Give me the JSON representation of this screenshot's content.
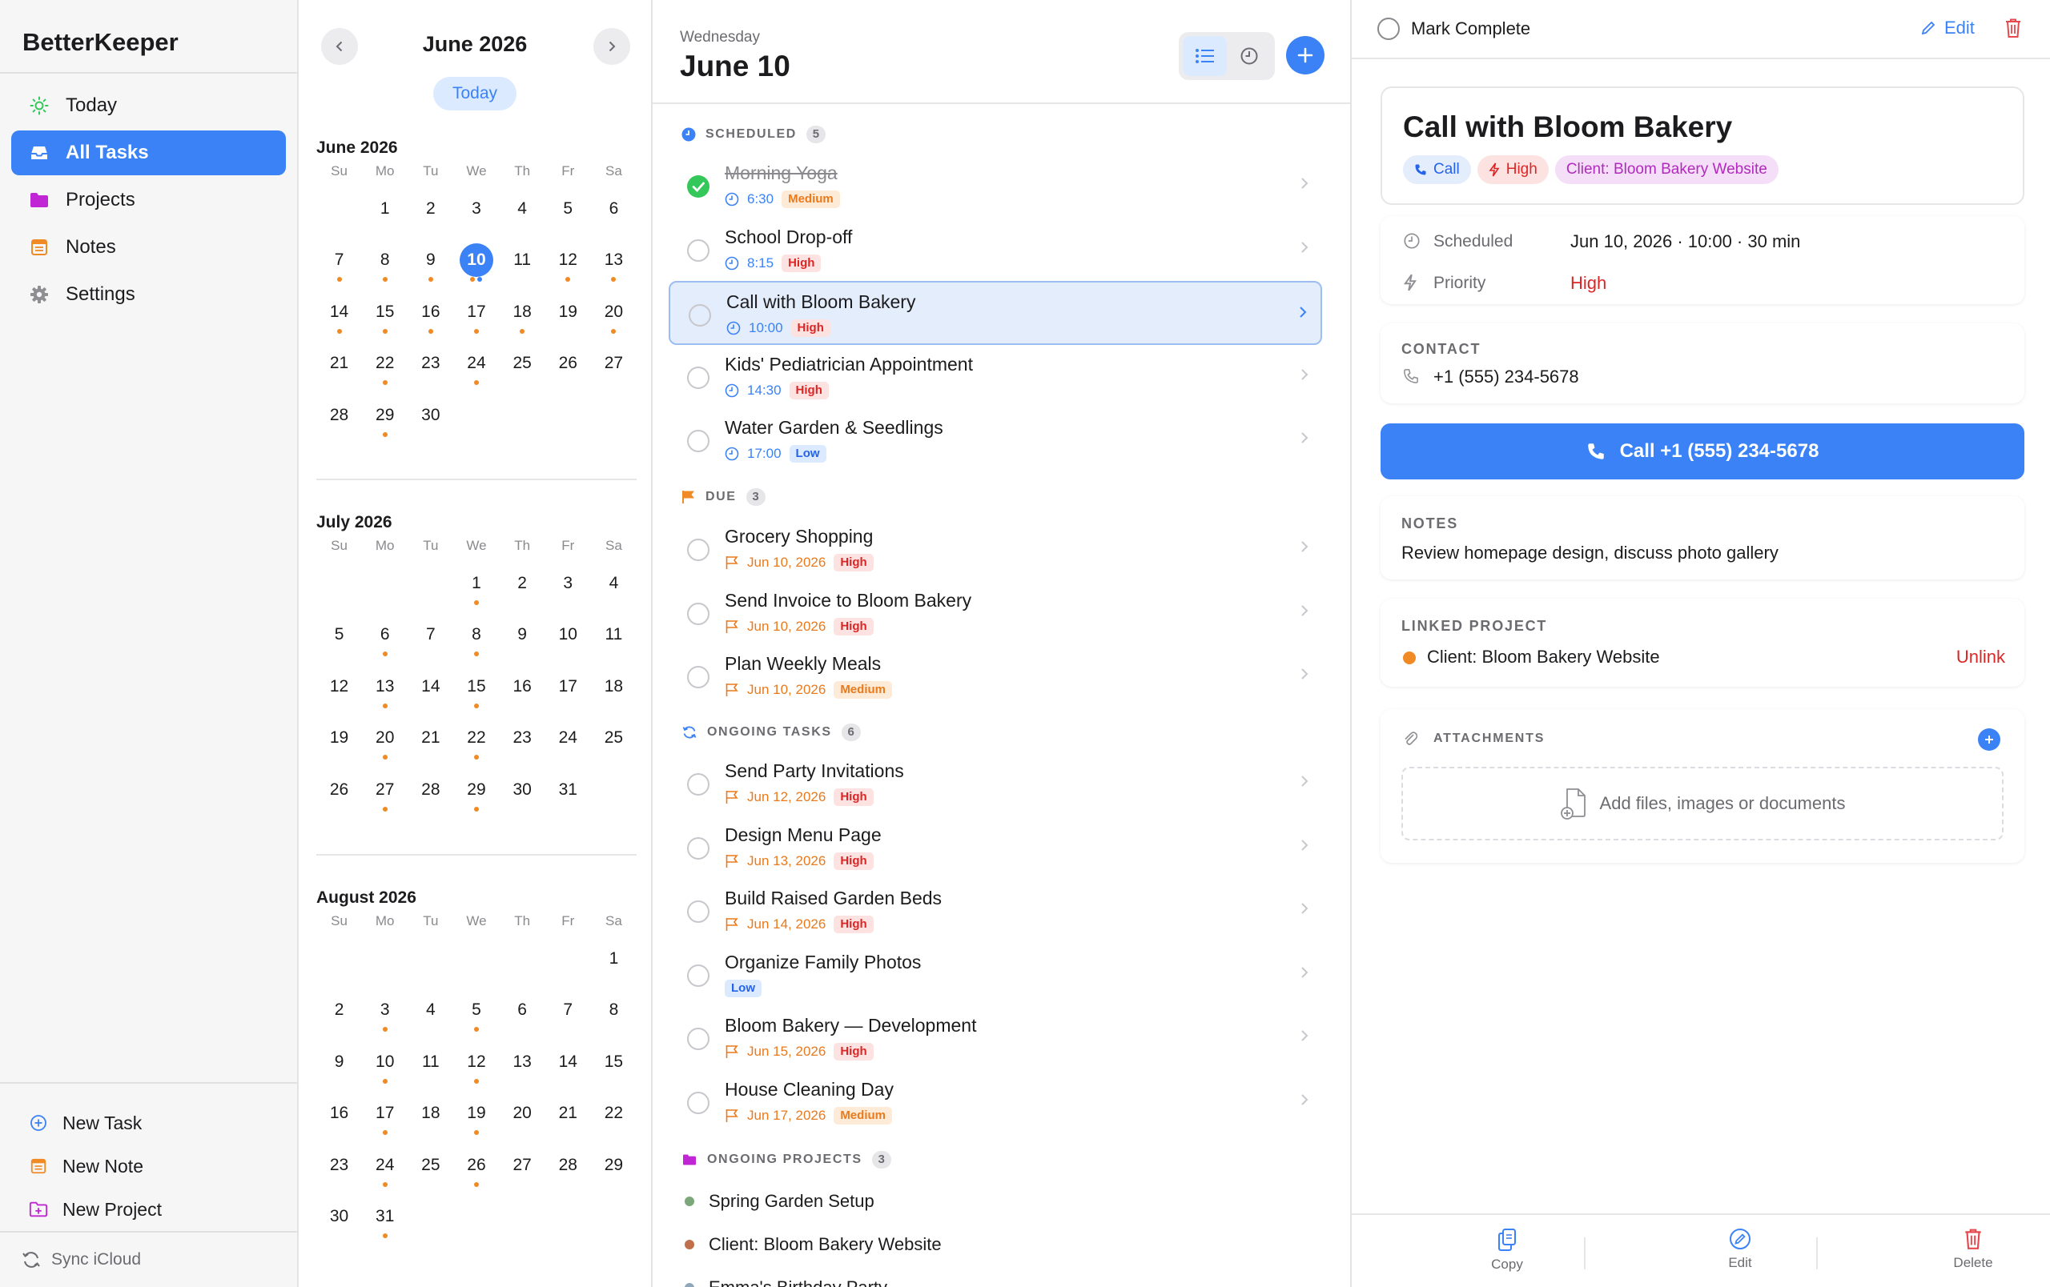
{
  "sidebar": {
    "app_name": "BetterKeeper",
    "nav": [
      {
        "label": "Today",
        "icon": "sun-icon"
      },
      {
        "label": "All Tasks",
        "icon": "inbox-icon",
        "active": true
      },
      {
        "label": "Projects",
        "icon": "folder-icon"
      },
      {
        "label": "Notes",
        "icon": "note-icon"
      },
      {
        "label": "Settings",
        "icon": "gear-icon"
      }
    ],
    "actions": [
      {
        "label": "New Task",
        "icon": "plus-circle-icon"
      },
      {
        "label": "New Note",
        "icon": "note-icon"
      },
      {
        "label": "New Project",
        "icon": "folder-plus-icon"
      }
    ],
    "sync_label": "Sync iCloud"
  },
  "calendar": {
    "title": "June 2026",
    "today_label": "Today",
    "weekdays": [
      "Su",
      "Mo",
      "Tu",
      "We",
      "Th",
      "Fr",
      "Sa"
    ],
    "months": [
      {
        "name": "June 2026",
        "first_weekday": 1,
        "days": 30,
        "selected": 10,
        "dots": {
          "7": [
            "o"
          ],
          "8": [
            "o"
          ],
          "9": [
            "o"
          ],
          "10": [
            "o",
            "b"
          ],
          "12": [
            "o"
          ],
          "13": [
            "o"
          ],
          "14": [
            "o"
          ],
          "15": [
            "o"
          ],
          "16": [
            "o"
          ],
          "17": [
            "o"
          ],
          "18": [
            "o"
          ],
          "20": [
            "o"
          ],
          "22": [
            "o"
          ],
          "24": [
            "o"
          ],
          "29": [
            "o"
          ]
        }
      },
      {
        "name": "July 2026",
        "first_weekday": 3,
        "days": 31,
        "selected": null,
        "dots": {
          "1": [
            "o"
          ],
          "6": [
            "o"
          ],
          "8": [
            "o"
          ],
          "13": [
            "o"
          ],
          "15": [
            "o"
          ],
          "20": [
            "o"
          ],
          "22": [
            "o"
          ],
          "27": [
            "o"
          ],
          "29": [
            "o"
          ]
        }
      },
      {
        "name": "August 2026",
        "first_weekday": 6,
        "days": 31,
        "selected": null,
        "dots": {
          "3": [
            "o"
          ],
          "5": [
            "o"
          ],
          "10": [
            "o"
          ],
          "12": [
            "o"
          ],
          "17": [
            "o"
          ],
          "19": [
            "o"
          ],
          "24": [
            "o"
          ],
          "26": [
            "o"
          ],
          "31": [
            "o"
          ]
        }
      }
    ]
  },
  "list": {
    "weekday": "Wednesday",
    "date": "June 10",
    "sections": [
      {
        "label": "SCHEDULED",
        "count": "5"
      },
      {
        "label": "DUE",
        "count": "3"
      },
      {
        "label": "ONGOING TASKS",
        "count": "6"
      },
      {
        "label": "ONGOING PROJECTS",
        "count": "3"
      }
    ],
    "scheduled": [
      {
        "title": "Morning Yoga",
        "time": "6:30",
        "priority": "Medium",
        "done": true
      },
      {
        "title": "School Drop-off",
        "time": "8:15",
        "priority": "High"
      },
      {
        "title": "Call with Bloom Bakery",
        "time": "10:00",
        "priority": "High",
        "selected": true
      },
      {
        "title": "Kids' Pediatrician Appointment",
        "time": "14:30",
        "priority": "High"
      },
      {
        "title": "Water Garden & Seedlings",
        "time": "17:00",
        "priority": "Low"
      }
    ],
    "due": [
      {
        "title": "Grocery Shopping",
        "date": "Jun 10, 2026",
        "priority": "High"
      },
      {
        "title": "Send Invoice to Bloom Bakery",
        "date": "Jun 10, 2026",
        "priority": "High"
      },
      {
        "title": "Plan Weekly Meals",
        "date": "Jun 10, 2026",
        "priority": "Medium"
      }
    ],
    "ongoing": [
      {
        "title": "Send Party Invitations",
        "date": "Jun 12, 2026",
        "priority": "High"
      },
      {
        "title": "Design Menu Page",
        "date": "Jun 13, 2026",
        "priority": "High"
      },
      {
        "title": "Build Raised Garden Beds",
        "date": "Jun 14, 2026",
        "priority": "High"
      },
      {
        "title": "Organize Family Photos",
        "date": "",
        "priority": "Low"
      },
      {
        "title": "Bloom Bakery — Development",
        "date": "Jun 15, 2026",
        "priority": "High"
      },
      {
        "title": "House Cleaning Day",
        "date": "Jun 17, 2026",
        "priority": "Medium"
      }
    ],
    "projects": [
      {
        "name": "Spring Garden Setup",
        "color": "#7aa87a"
      },
      {
        "name": "Client: Bloom Bakery Website",
        "color": "#c0704a"
      },
      {
        "name": "Emma's Birthday Party",
        "color": "#8fa6b8"
      }
    ]
  },
  "detail": {
    "mark_complete": "Mark Complete",
    "edit_label": "Edit",
    "title": "Call with Bloom Bakery",
    "chips": {
      "type": "Call",
      "priority": "High",
      "project": "Client: Bloom Bakery Website"
    },
    "scheduled_label": "Scheduled",
    "scheduled_value": "Jun 10, 2026 · 10:00 · 30 min",
    "priority_label": "Priority",
    "priority_value": "High",
    "contact_label": "CONTACT",
    "contact_phone": "+1 (555) 234-5678",
    "call_button": "Call +1 (555) 234-5678",
    "notes_label": "NOTES",
    "notes_text": "Review homepage design, discuss photo gallery",
    "linked_label": "LINKED PROJECT",
    "linked_project": "Client: Bloom Bakery Website",
    "unlink_label": "Unlink",
    "attachments_label": "ATTACHMENTS",
    "attachments_placeholder": "Add files, images or documents",
    "footer": {
      "copy": "Copy",
      "edit": "Edit",
      "delete": "Delete"
    }
  },
  "colors": {
    "accent": "#3b82f6",
    "high": "#dc2626",
    "medium": "#ea7a1c",
    "low": "#2563eb",
    "done": "#34c759",
    "project_magenta": "#c026d3",
    "linked_dot": "#f08a24"
  }
}
